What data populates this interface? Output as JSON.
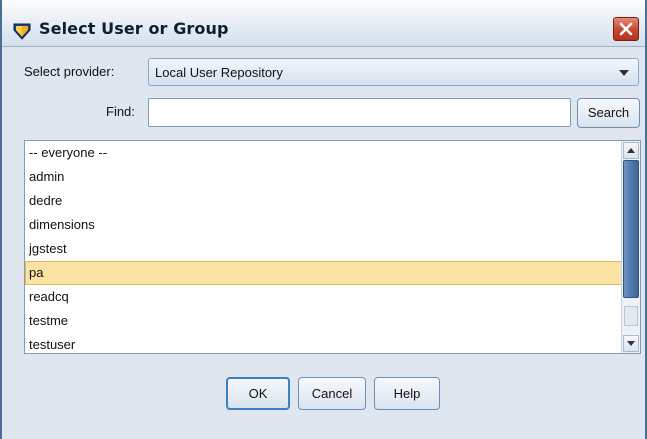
{
  "window": {
    "title": "Select User or Group",
    "accent": "#4a6f97",
    "close_color": "#c8452f"
  },
  "icons": {
    "app": "diamond-shield-icon",
    "close": "close-icon",
    "dropdown": "chevron-down-icon",
    "scroll_up": "arrow-up-icon",
    "scroll_down": "arrow-down-icon"
  },
  "provider": {
    "label": "Select provider:",
    "selected": "Local User Repository"
  },
  "find": {
    "label": "Find:",
    "value": "",
    "placeholder": ""
  },
  "search_button": "Search",
  "list": {
    "items": [
      "-- everyone --",
      "admin",
      "dedre",
      "dimensions",
      "jgstest",
      "pa",
      "readcq",
      "testme",
      "testuser"
    ],
    "selected": "pa",
    "selected_color": "#fbe3a4"
  },
  "buttons": {
    "ok": "OK",
    "cancel": "Cancel",
    "help": "Help"
  }
}
